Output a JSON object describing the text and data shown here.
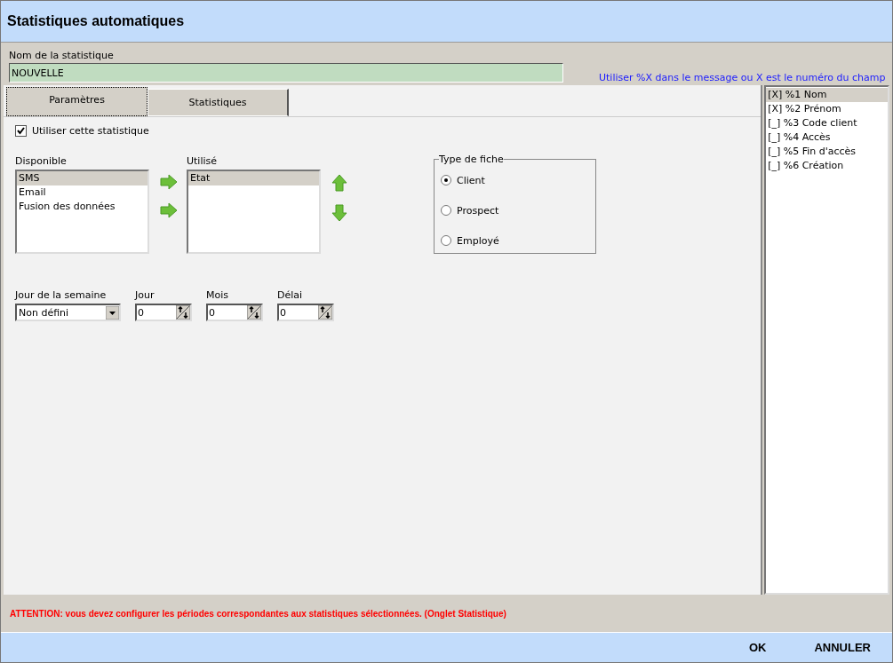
{
  "window": {
    "title": "Statistiques automatiques"
  },
  "name_field": {
    "label": "Nom de la statistique",
    "value": "NOUVELLE"
  },
  "hint": "Utiliser %X dans le message ou X est le numéro du champ",
  "tabs": [
    {
      "label": "Paramètres",
      "selected": true
    },
    {
      "label": "Statistiques",
      "selected": false
    }
  ],
  "use_checkbox": {
    "label": "Utiliser cette statistique",
    "checked": true
  },
  "available": {
    "label": "Disponible",
    "items": [
      {
        "label": "SMS",
        "selected": true
      },
      {
        "label": "Email",
        "selected": false
      },
      {
        "label": "Fusion des données",
        "selected": false
      }
    ]
  },
  "used": {
    "label": "Utilisé",
    "items": [
      {
        "label": "Etat",
        "selected": true
      }
    ]
  },
  "record_type": {
    "label": "Type de fiche",
    "options": [
      {
        "label": "Client",
        "selected": true
      },
      {
        "label": "Prospect",
        "selected": false
      },
      {
        "label": "Employé",
        "selected": false
      }
    ]
  },
  "weekday": {
    "label": "Jour de la semaine",
    "value": "Non défini"
  },
  "spinners": [
    {
      "label": "Jour",
      "value": "0"
    },
    {
      "label": "Mois",
      "value": "0"
    },
    {
      "label": "Délai",
      "value": "0"
    }
  ],
  "fields": [
    {
      "label": "[X] %1 Nom",
      "selected": true
    },
    {
      "label": "[X] %2 Prénom",
      "selected": false
    },
    {
      "label": "[_] %3 Code client",
      "selected": false
    },
    {
      "label": "[_] %4 Accès",
      "selected": false
    },
    {
      "label": "[_] %5 Fin d'accès",
      "selected": false
    },
    {
      "label": "[_] %6 Création",
      "selected": false
    }
  ],
  "warning": "ATTENTION: vous devez configurer les périodes correspondantes aux statistiques sélectionnées. (Onglet Statistique)",
  "buttons": [
    "OK",
    "ANNULER"
  ]
}
